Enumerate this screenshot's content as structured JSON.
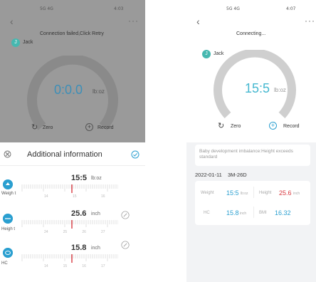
{
  "left": {
    "status_bar": {
      "left": "5G 4G",
      "right": "4:03"
    },
    "message": "Connection failed,Click Retry",
    "user": {
      "name": "Jack",
      "initial": "J"
    },
    "weight": {
      "value": "0:0.0",
      "unit": "lb:oz"
    },
    "actions": {
      "zero_label": "Zero",
      "record_label": "Record"
    },
    "sheet": {
      "title": "Additional information",
      "rows": [
        {
          "label": "Weigh t",
          "value": "15:5",
          "unit": "lb:oz",
          "ticks": [
            "14",
            "15",
            "16"
          ]
        },
        {
          "label": "Heigh t",
          "value": "25.6",
          "unit": "inch",
          "ticks": [
            "24",
            "25",
            "26",
            "27"
          ]
        },
        {
          "label": "HC",
          "value": "15.8",
          "unit": "inch",
          "ticks": [
            "14",
            "15",
            "16",
            "17"
          ]
        }
      ]
    }
  },
  "right": {
    "status_bar": {
      "left": "5G 4G",
      "right": "4:07"
    },
    "message": "Connecting...",
    "user": {
      "name": "Jack",
      "initial": "J"
    },
    "weight": {
      "value": "15:5",
      "unit": "lb:oz",
      "fill_fraction": 1.0
    },
    "actions": {
      "zero_label": "Zero",
      "record_label": "Record"
    },
    "notice": "Baby development imbalance:Height exceeds standard",
    "record": {
      "date": "2022-01-11",
      "age": "3M-26D",
      "weight_label": "Weight",
      "weight_value": "15:5",
      "weight_unit": "lb:oz",
      "height_label": "Height",
      "height_value": "25.6",
      "height_unit": "inch",
      "hc_label": "HC",
      "hc_value": "15.8",
      "hc_unit": "inch",
      "bmi_label": "BMI",
      "bmi_value": "16.32"
    }
  },
  "colors": {
    "accent": "#2a9fd0",
    "warning": "#d8383f",
    "dim": "#9a9a9a",
    "avatar": "#46b8b0"
  }
}
